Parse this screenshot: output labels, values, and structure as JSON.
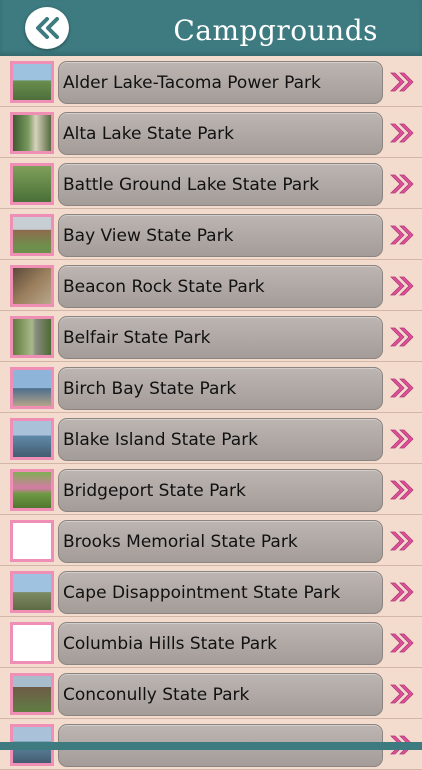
{
  "header": {
    "title": "Campgrounds",
    "back_icon": "double-chevron-left-icon",
    "color": "#3d7b80"
  },
  "list": {
    "items": [
      {
        "label": "Alder Lake-Tacoma Power Park",
        "thumb": "sky"
      },
      {
        "label": "Alta Lake State Park",
        "thumb": "trees"
      },
      {
        "label": "Battle Ground Lake State Park",
        "thumb": "green"
      },
      {
        "label": "Bay View State Park",
        "thumb": "house"
      },
      {
        "label": "Beacon Rock State Park",
        "thumb": "rock"
      },
      {
        "label": "Belfair State Park",
        "thumb": "path"
      },
      {
        "label": "Birch Bay State Park",
        "thumb": "beach"
      },
      {
        "label": "Blake Island State Park",
        "thumb": "water"
      },
      {
        "label": "Bridgeport State Park",
        "thumb": "flowers"
      },
      {
        "label": "Brooks Memorial State Park",
        "thumb": "blank"
      },
      {
        "label": "Cape Disappointment State Park",
        "thumb": "light"
      },
      {
        "label": "Columbia Hills State Park",
        "thumb": "blank"
      },
      {
        "label": "Conconully State Park",
        "thumb": "cabin"
      },
      {
        "label": "",
        "thumb": "water"
      }
    ],
    "row_icon": "double-chevron-right-icon",
    "accent_color": "#e0509a"
  }
}
